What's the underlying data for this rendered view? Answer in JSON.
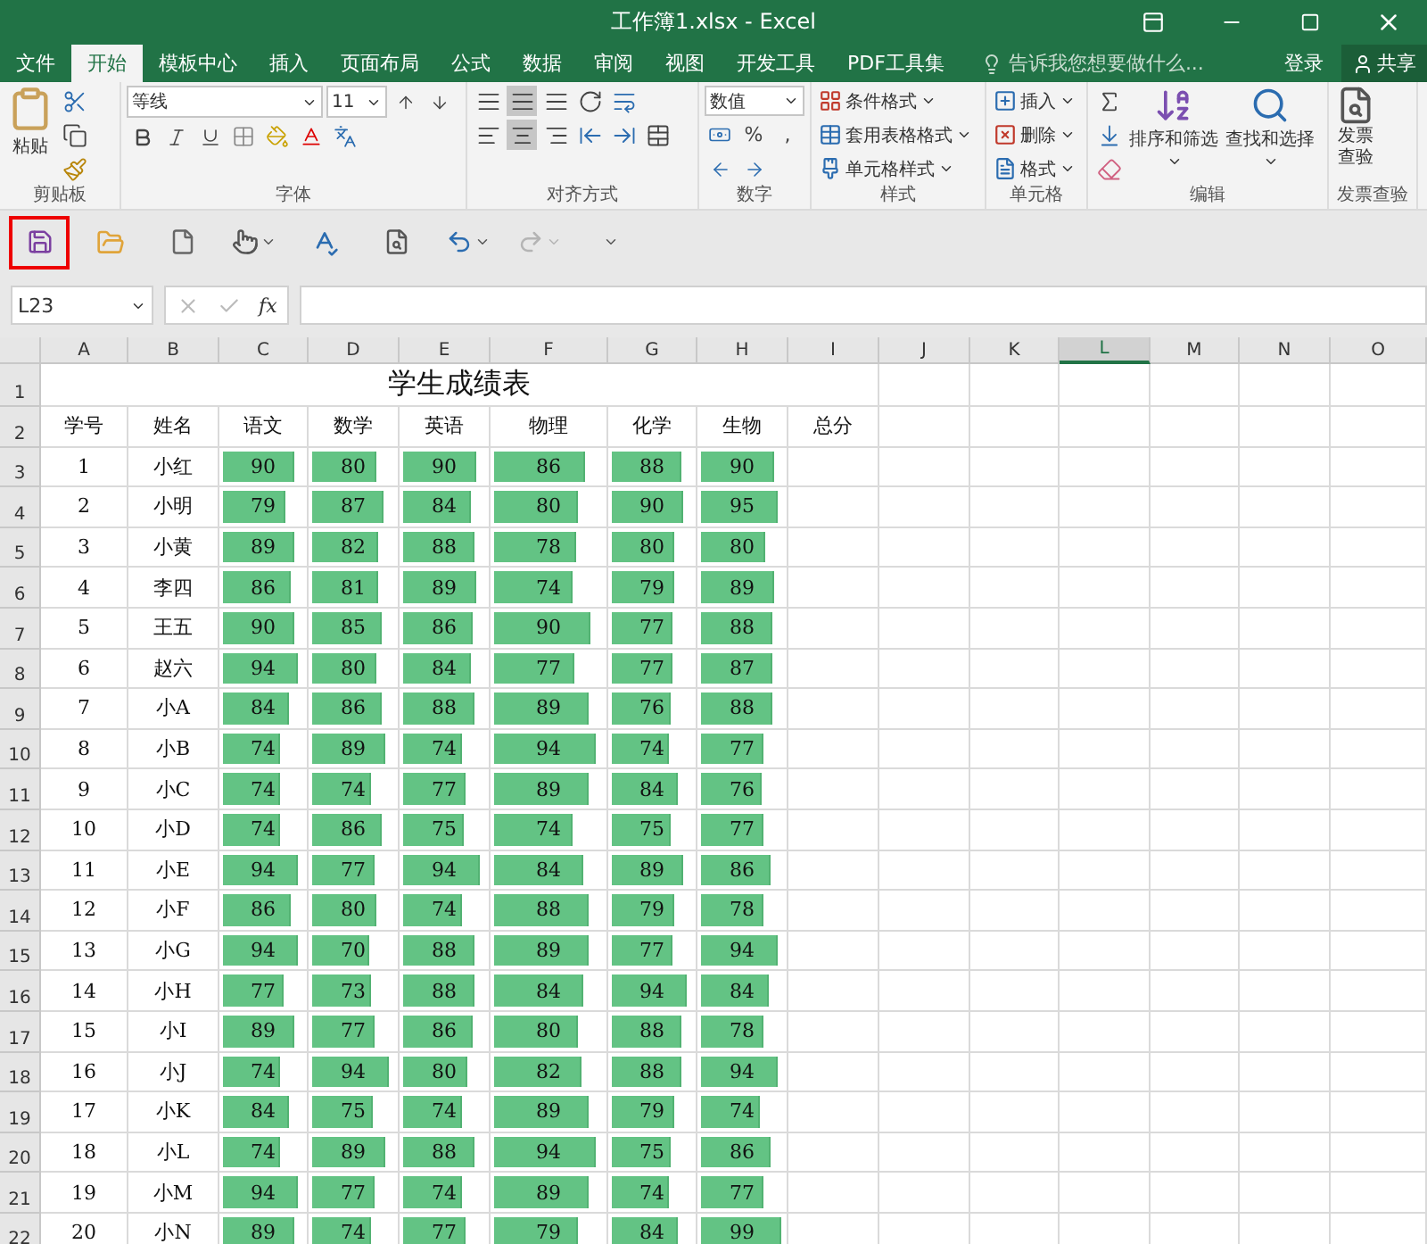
{
  "window": {
    "title": "工作簿1.xlsx - Excel"
  },
  "tabs": [
    {
      "label": "文件",
      "selected": false
    },
    {
      "label": "开始",
      "selected": true
    },
    {
      "label": "模板中心",
      "selected": false
    },
    {
      "label": "插入",
      "selected": false
    },
    {
      "label": "页面布局",
      "selected": false
    },
    {
      "label": "公式",
      "selected": false
    },
    {
      "label": "数据",
      "selected": false
    },
    {
      "label": "审阅",
      "selected": false
    },
    {
      "label": "视图",
      "selected": false
    },
    {
      "label": "开发工具",
      "selected": false
    },
    {
      "label": "PDF工具集",
      "selected": false
    }
  ],
  "tell_me": {
    "placeholder": "告诉我您想要做什么..."
  },
  "sign_in": "登录",
  "share": "共享",
  "ribbon": {
    "clipboard": {
      "paste": "粘贴",
      "label": "剪贴板"
    },
    "font": {
      "name": "等线",
      "size": "11",
      "label": "字体"
    },
    "alignment": {
      "label": "对齐方式"
    },
    "number": {
      "format": "数值",
      "percent": "%",
      "comma": ",",
      "label": "数字"
    },
    "styles": {
      "items": [
        "条件格式",
        "套用表格格式",
        "单元格样式"
      ],
      "label": "样式"
    },
    "cells": {
      "items": [
        "插入",
        "删除",
        "格式"
      ],
      "label": "单元格"
    },
    "editing": {
      "sort": "排序和筛选",
      "find": "查找和选择",
      "label": "编辑"
    },
    "invoice": {
      "button": "发票查验",
      "label": "发票查验"
    }
  },
  "quick_access": [
    {
      "kind": "save",
      "highlighted": true,
      "disabled": false
    },
    {
      "kind": "open",
      "highlighted": false,
      "disabled": false
    },
    {
      "kind": "new",
      "highlighted": false,
      "disabled": false
    },
    {
      "kind": "touch",
      "highlighted": false,
      "disabled": false
    },
    {
      "kind": "spelling",
      "highlighted": false,
      "disabled": false
    },
    {
      "kind": "preview",
      "highlighted": false,
      "disabled": false
    },
    {
      "kind": "undo",
      "highlighted": false,
      "disabled": false
    },
    {
      "kind": "redo",
      "highlighted": false,
      "disabled": true
    },
    {
      "kind": "customize",
      "highlighted": false,
      "disabled": false
    }
  ],
  "formula_bar": {
    "name_box": "L23",
    "fx": "fx"
  },
  "sheet": {
    "columns": [
      {
        "label": "A",
        "selected": false
      },
      {
        "label": "B",
        "selected": false
      },
      {
        "label": "C",
        "selected": false
      },
      {
        "label": "D",
        "selected": false
      },
      {
        "label": "E",
        "selected": false
      },
      {
        "label": "F",
        "selected": false
      },
      {
        "label": "G",
        "selected": false
      },
      {
        "label": "H",
        "selected": false
      },
      {
        "label": "I",
        "selected": false
      },
      {
        "label": "J",
        "selected": false
      },
      {
        "label": "K",
        "selected": false
      },
      {
        "label": "L",
        "selected": true
      },
      {
        "label": "M",
        "selected": false
      },
      {
        "label": "N",
        "selected": false
      },
      {
        "label": "O",
        "selected": false
      }
    ],
    "title_row": {
      "number": "1",
      "title": "学生成绩表"
    },
    "header_row": {
      "number": "2",
      "headers": [
        "学号",
        "姓名",
        "语文",
        "数学",
        "英语",
        "物理",
        "化学",
        "生物",
        "总分"
      ]
    },
    "rows": [
      {
        "number": "3",
        "id": "1",
        "name": "小红",
        "scores": [
          {
            "value": "90",
            "level": 0.86
          },
          {
            "value": "80",
            "level": 0.76
          },
          {
            "value": "90",
            "level": 0.86
          },
          {
            "value": "86",
            "level": 0.82
          },
          {
            "value": "88",
            "level": 0.84
          },
          {
            "value": "90",
            "level": 0.86
          }
        ]
      },
      {
        "number": "4",
        "id": "2",
        "name": "小明",
        "scores": [
          {
            "value": "79",
            "level": 0.75
          },
          {
            "value": "87",
            "level": 0.83
          },
          {
            "value": "84",
            "level": 0.8
          },
          {
            "value": "80",
            "level": 0.76
          },
          {
            "value": "90",
            "level": 0.86
          },
          {
            "value": "95",
            "level": 0.9
          }
        ]
      },
      {
        "number": "5",
        "id": "3",
        "name": "小黄",
        "scores": [
          {
            "value": "89",
            "level": 0.85
          },
          {
            "value": "82",
            "level": 0.78
          },
          {
            "value": "88",
            "level": 0.84
          },
          {
            "value": "78",
            "level": 0.74
          },
          {
            "value": "80",
            "level": 0.76
          },
          {
            "value": "80",
            "level": 0.76
          }
        ]
      },
      {
        "number": "6",
        "id": "4",
        "name": "李四",
        "scores": [
          {
            "value": "86",
            "level": 0.82
          },
          {
            "value": "81",
            "level": 0.77
          },
          {
            "value": "89",
            "level": 0.85
          },
          {
            "value": "74",
            "level": 0.7
          },
          {
            "value": "79",
            "level": 0.75
          },
          {
            "value": "89",
            "level": 0.85
          }
        ]
      },
      {
        "number": "7",
        "id": "5",
        "name": "王五",
        "scores": [
          {
            "value": "90",
            "level": 0.86
          },
          {
            "value": "85",
            "level": 0.81
          },
          {
            "value": "86",
            "level": 0.82
          },
          {
            "value": "90",
            "level": 0.86
          },
          {
            "value": "77",
            "level": 0.73
          },
          {
            "value": "88",
            "level": 0.84
          }
        ]
      },
      {
        "number": "8",
        "id": "6",
        "name": "赵六",
        "scores": [
          {
            "value": "94",
            "level": 0.9
          },
          {
            "value": "80",
            "level": 0.76
          },
          {
            "value": "84",
            "level": 0.8
          },
          {
            "value": "77",
            "level": 0.73
          },
          {
            "value": "77",
            "level": 0.73
          },
          {
            "value": "87",
            "level": 0.83
          }
        ]
      },
      {
        "number": "9",
        "id": "7",
        "name": "小A",
        "scores": [
          {
            "value": "84",
            "level": 0.8
          },
          {
            "value": "86",
            "level": 0.82
          },
          {
            "value": "88",
            "level": 0.84
          },
          {
            "value": "89",
            "level": 0.85
          },
          {
            "value": "76",
            "level": 0.72
          },
          {
            "value": "88",
            "level": 0.84
          }
        ]
      },
      {
        "number": "10",
        "id": "8",
        "name": "小B",
        "scores": [
          {
            "value": "74",
            "level": 0.7
          },
          {
            "value": "89",
            "level": 0.85
          },
          {
            "value": "74",
            "level": 0.7
          },
          {
            "value": "94",
            "level": 0.9
          },
          {
            "value": "74",
            "level": 0.7
          },
          {
            "value": "77",
            "level": 0.73
          }
        ]
      },
      {
        "number": "11",
        "id": "9",
        "name": "小C",
        "scores": [
          {
            "value": "74",
            "level": 0.7
          },
          {
            "value": "74",
            "level": 0.7
          },
          {
            "value": "77",
            "level": 0.73
          },
          {
            "value": "89",
            "level": 0.85
          },
          {
            "value": "84",
            "level": 0.8
          },
          {
            "value": "76",
            "level": 0.72
          }
        ]
      },
      {
        "number": "12",
        "id": "10",
        "name": "小D",
        "scores": [
          {
            "value": "74",
            "level": 0.7
          },
          {
            "value": "86",
            "level": 0.82
          },
          {
            "value": "75",
            "level": 0.71
          },
          {
            "value": "74",
            "level": 0.7
          },
          {
            "value": "75",
            "level": 0.71
          },
          {
            "value": "77",
            "level": 0.73
          }
        ]
      },
      {
        "number": "13",
        "id": "11",
        "name": "小E",
        "scores": [
          {
            "value": "94",
            "level": 0.9
          },
          {
            "value": "77",
            "level": 0.73
          },
          {
            "value": "94",
            "level": 0.9
          },
          {
            "value": "84",
            "level": 0.8
          },
          {
            "value": "89",
            "level": 0.85
          },
          {
            "value": "86",
            "level": 0.82
          }
        ]
      },
      {
        "number": "14",
        "id": "12",
        "name": "小F",
        "scores": [
          {
            "value": "86",
            "level": 0.82
          },
          {
            "value": "80",
            "level": 0.76
          },
          {
            "value": "74",
            "level": 0.7
          },
          {
            "value": "88",
            "level": 0.84
          },
          {
            "value": "79",
            "level": 0.75
          },
          {
            "value": "78",
            "level": 0.74
          }
        ]
      },
      {
        "number": "15",
        "id": "13",
        "name": "小G",
        "scores": [
          {
            "value": "94",
            "level": 0.9
          },
          {
            "value": "70",
            "level": 0.67
          },
          {
            "value": "88",
            "level": 0.84
          },
          {
            "value": "89",
            "level": 0.85
          },
          {
            "value": "77",
            "level": 0.73
          },
          {
            "value": "94",
            "level": 0.9
          }
        ]
      },
      {
        "number": "16",
        "id": "14",
        "name": "小H",
        "scores": [
          {
            "value": "77",
            "level": 0.73
          },
          {
            "value": "73",
            "level": 0.7
          },
          {
            "value": "88",
            "level": 0.84
          },
          {
            "value": "84",
            "level": 0.8
          },
          {
            "value": "94",
            "level": 0.9
          },
          {
            "value": "84",
            "level": 0.8
          }
        ]
      },
      {
        "number": "17",
        "id": "15",
        "name": "小I",
        "scores": [
          {
            "value": "89",
            "level": 0.85
          },
          {
            "value": "77",
            "level": 0.73
          },
          {
            "value": "86",
            "level": 0.82
          },
          {
            "value": "80",
            "level": 0.76
          },
          {
            "value": "88",
            "level": 0.84
          },
          {
            "value": "78",
            "level": 0.74
          }
        ]
      },
      {
        "number": "18",
        "id": "16",
        "name": "小J",
        "scores": [
          {
            "value": "74",
            "level": 0.7
          },
          {
            "value": "94",
            "level": 0.9
          },
          {
            "value": "80",
            "level": 0.76
          },
          {
            "value": "82",
            "level": 0.78
          },
          {
            "value": "88",
            "level": 0.84
          },
          {
            "value": "94",
            "level": 0.9
          }
        ]
      },
      {
        "number": "19",
        "id": "17",
        "name": "小K",
        "scores": [
          {
            "value": "84",
            "level": 0.8
          },
          {
            "value": "75",
            "level": 0.71
          },
          {
            "value": "74",
            "level": 0.7
          },
          {
            "value": "89",
            "level": 0.85
          },
          {
            "value": "79",
            "level": 0.75
          },
          {
            "value": "74",
            "level": 0.7
          }
        ]
      },
      {
        "number": "20",
        "id": "18",
        "name": "小L",
        "scores": [
          {
            "value": "74",
            "level": 0.7
          },
          {
            "value": "89",
            "level": 0.85
          },
          {
            "value": "88",
            "level": 0.84
          },
          {
            "value": "94",
            "level": 0.9
          },
          {
            "value": "75",
            "level": 0.71
          },
          {
            "value": "86",
            "level": 0.82
          }
        ]
      },
      {
        "number": "21",
        "id": "19",
        "name": "小M",
        "scores": [
          {
            "value": "94",
            "level": 0.9
          },
          {
            "value": "77",
            "level": 0.73
          },
          {
            "value": "74",
            "level": 0.7
          },
          {
            "value": "89",
            "level": 0.85
          },
          {
            "value": "74",
            "level": 0.7
          },
          {
            "value": "77",
            "level": 0.73
          }
        ]
      },
      {
        "number": "22",
        "id": "20",
        "name": "小N",
        "scores": [
          {
            "value": "89",
            "level": 0.85
          },
          {
            "value": "74",
            "level": 0.7
          },
          {
            "value": "77",
            "level": 0.73
          },
          {
            "value": "79",
            "level": 0.75
          },
          {
            "value": "84",
            "level": 0.8
          },
          {
            "value": "99",
            "level": 0.94
          }
        ]
      }
    ]
  }
}
